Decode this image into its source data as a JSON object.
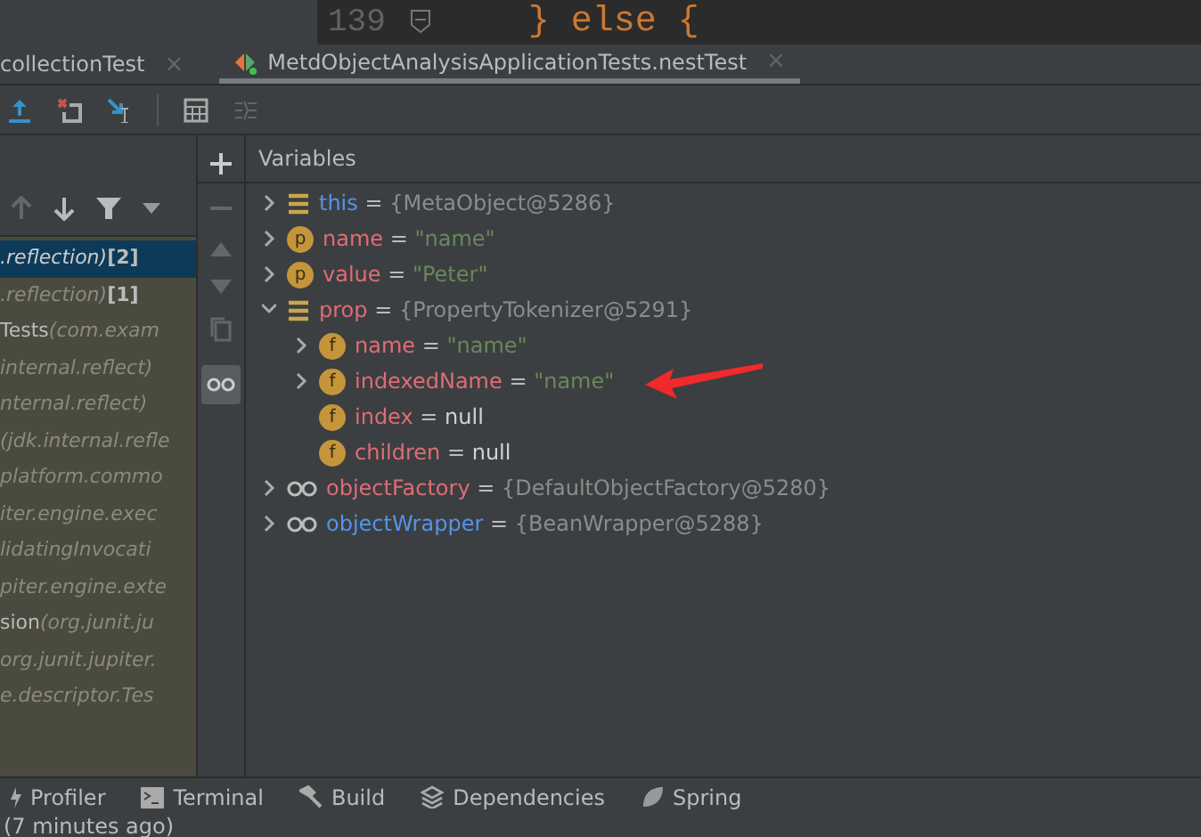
{
  "editor": {
    "line_number": "139",
    "code": "} else {"
  },
  "tabs": [
    {
      "label": "collectionTest",
      "close": "×",
      "selected": false
    },
    {
      "label": "MetdObjectAnalysisApplicationTests.nestTest",
      "close": "×",
      "selected": true
    }
  ],
  "frames": [
    {
      "location": ".reflection)",
      "count": "[2]",
      "selected": true
    },
    {
      "location": ".reflection)",
      "count": "[1]",
      "selected": false
    },
    {
      "name": "Tests",
      "location": "(com.exam",
      "selected": false
    },
    {
      "location": "internal.reflect)",
      "selected": false
    },
    {
      "location": "nternal.reflect)",
      "selected": false
    },
    {
      "location": "(jdk.internal.refle",
      "selected": false
    },
    {
      "location": "platform.commo",
      "selected": false
    },
    {
      "location": "iter.engine.exec",
      "selected": false
    },
    {
      "location": "lidatingInvocati",
      "selected": false
    },
    {
      "location": "piter.engine.exte",
      "selected": false
    },
    {
      "name": "sion",
      "location": "(org.junit.ju",
      "selected": false
    },
    {
      "location": "org.junit.jupiter.",
      "selected": false
    },
    {
      "location": "e.descriptor.Tes",
      "selected": false
    }
  ],
  "variables_panel": {
    "title": "Variables",
    "watches_on": true,
    "variables": [
      {
        "kind": "list",
        "name": "this",
        "color": "#5394ec",
        "operator": "=",
        "value": {
          "text": "{MetaObject@5286}",
          "color": "#8c8c8c"
        },
        "expandable": true,
        "expanded": false
      },
      {
        "kind": "badge",
        "badge": "p",
        "name": "name",
        "color": "#e06c75",
        "operator": "=",
        "value": {
          "text": "\"name\"",
          "color": "#6a8759"
        },
        "expandable": true,
        "expanded": false
      },
      {
        "kind": "badge",
        "badge": "p",
        "name": "value",
        "color": "#e06c75",
        "operator": "=",
        "value": {
          "text": "\"Peter\"",
          "color": "#6a8759"
        },
        "expandable": true,
        "expanded": false
      },
      {
        "kind": "list",
        "name": "prop",
        "color": "#e06c75",
        "operator": "=",
        "value": {
          "text": "{PropertyTokenizer@5291}",
          "color": "#8c8c8c"
        },
        "expandable": true,
        "expanded": true,
        "children": [
          {
            "kind": "badge",
            "badge": "f",
            "name": "name",
            "color": "#e06c75",
            "operator": "=",
            "value": {
              "text": "\"name\"",
              "color": "#6a8759"
            },
            "expandable": true,
            "expanded": false
          },
          {
            "kind": "badge",
            "badge": "f",
            "name": "indexedName",
            "color": "#e06c75",
            "operator": "=",
            "value": {
              "text": "\"name\"",
              "color": "#6a8759"
            },
            "expandable": true,
            "expanded": false,
            "annotated": true
          },
          {
            "kind": "badge",
            "badge": "f",
            "name": "index",
            "color": "#e06c75",
            "operator": "=",
            "value": {
              "text": "null",
              "color": "#cfd3d6"
            },
            "expandable": false
          },
          {
            "kind": "badge",
            "badge": "f",
            "name": "children",
            "color": "#e06c75",
            "operator": "=",
            "value": {
              "text": "null",
              "color": "#cfd3d6"
            },
            "expandable": false
          }
        ]
      },
      {
        "kind": "watch",
        "name": "objectFactory",
        "color": "#e06c75",
        "operator": "=",
        "value": {
          "text": "{DefaultObjectFactory@5280}",
          "color": "#8c8c8c"
        },
        "expandable": true,
        "expanded": false
      },
      {
        "kind": "watch",
        "name": "objectWrapper",
        "color": "#5394ec",
        "operator": "=",
        "value": {
          "text": "{BeanWrapper@5288}",
          "color": "#8c8c8c"
        },
        "expandable": true,
        "expanded": false
      }
    ]
  },
  "tool_windows": [
    {
      "kind": "profiler",
      "label": "Profiler"
    },
    {
      "kind": "terminal",
      "label": "Terminal"
    },
    {
      "kind": "build",
      "label": "Build"
    },
    {
      "kind": "dependencies",
      "label": "Dependencies"
    },
    {
      "kind": "spring",
      "label": "Spring"
    }
  ],
  "status_bar": {
    "text": "(7 minutes ago)"
  }
}
